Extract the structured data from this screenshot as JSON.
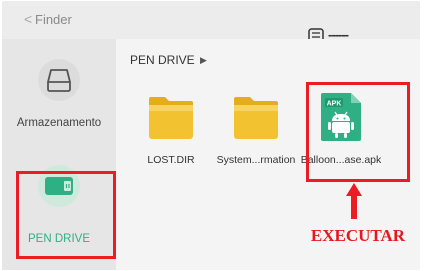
{
  "topbar": {
    "back_glyph": "<",
    "title": "Finder",
    "usb_status_text": "------",
    "usb_icon": "usb-connection-icon"
  },
  "sidebar": {
    "items": [
      {
        "label": "Armazenamento",
        "icon": "storage-drive-icon",
        "selected": false
      },
      {
        "label": "PEN DRIVE",
        "icon": "pen-drive-icon",
        "selected": true
      }
    ]
  },
  "main": {
    "breadcrumb": "PEN DRIVE",
    "breadcrumb_arrow": "▶",
    "files": [
      {
        "name": "LOST.DIR",
        "icon": "folder-icon"
      },
      {
        "name": "System...rmation",
        "icon": "folder-icon"
      },
      {
        "name": "Balloon...ase.apk",
        "icon": "apk-file-icon",
        "badge": "APK"
      }
    ]
  },
  "annotation": {
    "text": "EXECUTAR",
    "color": "#e4181f"
  },
  "colors": {
    "accent": "#2fb084",
    "folder": "#f2c230",
    "apk": "#2fb084",
    "highlight": "#ec1c24"
  }
}
